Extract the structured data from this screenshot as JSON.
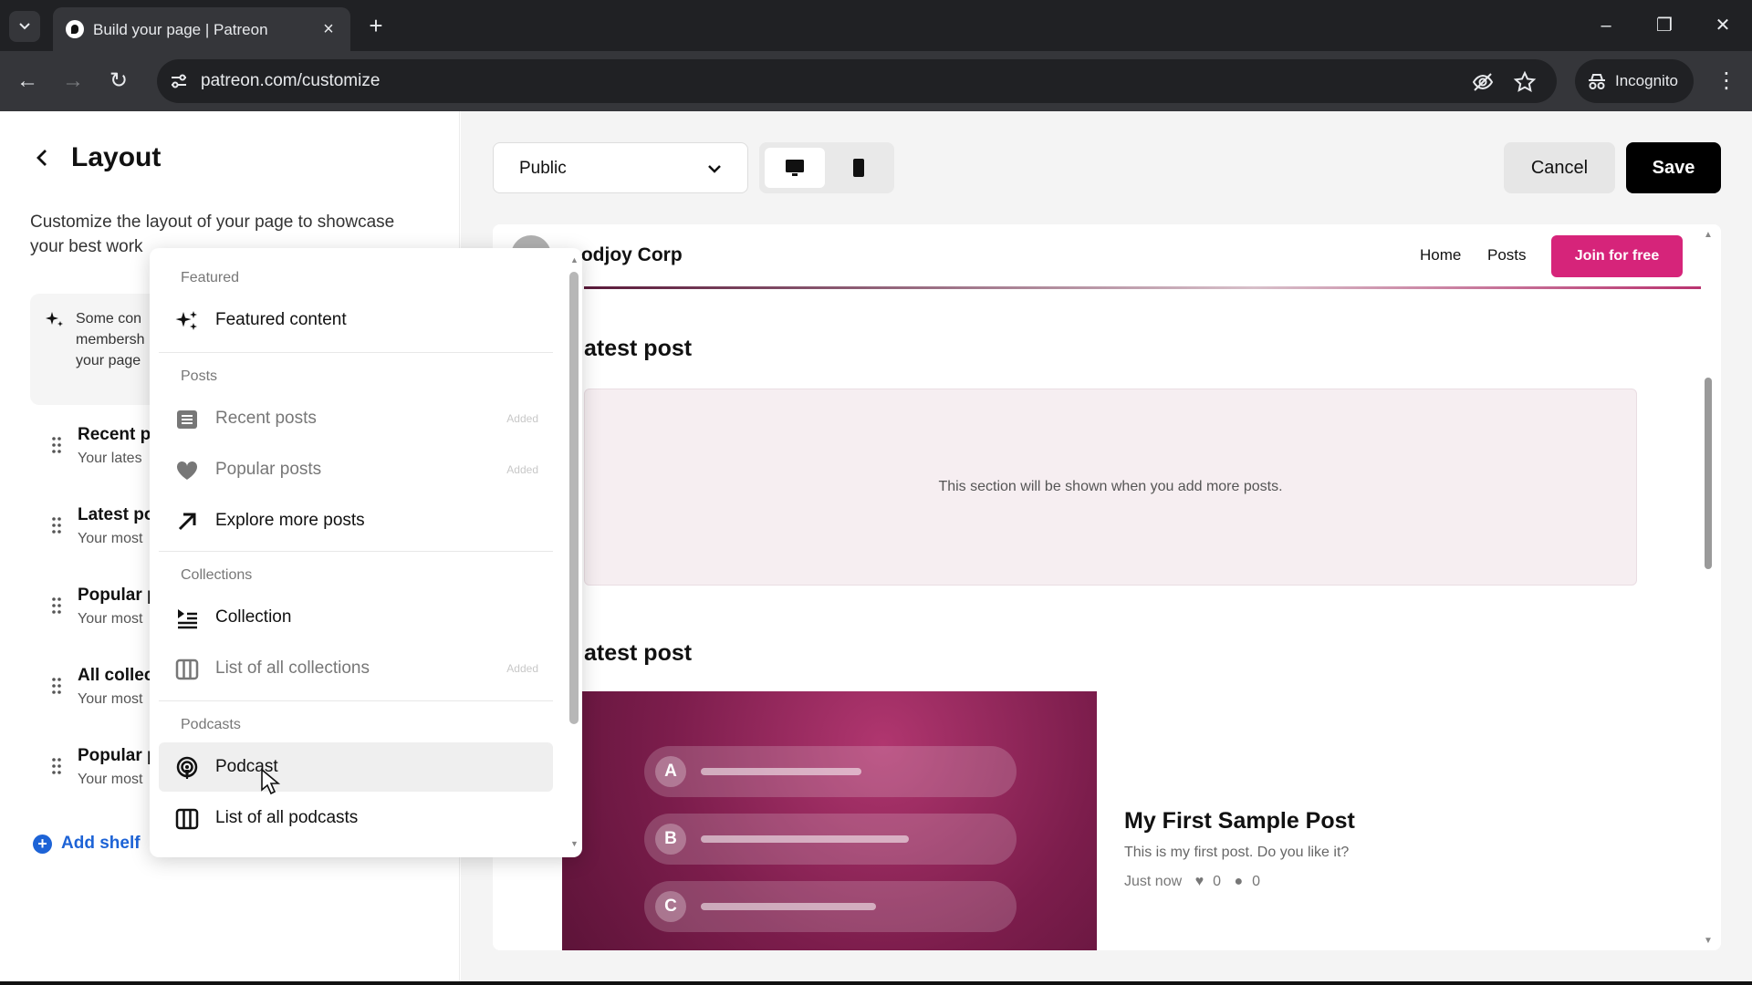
{
  "browser": {
    "tab_title": "Build your page | Patreon",
    "url": "patreon.com/customize",
    "incognito_label": "Incognito"
  },
  "left_panel": {
    "title": "Layout",
    "description": "Customize the layout of your page to showcase your best work",
    "info_lines": [
      "Some con",
      "membersh",
      "your page"
    ],
    "shelves": [
      {
        "title": "Recent p",
        "subtitle": "Your lates"
      },
      {
        "title": "Latest po",
        "subtitle": "Your most"
      },
      {
        "title": "Popular p",
        "subtitle": "Your most"
      },
      {
        "title": "All collec",
        "subtitle": "Your most"
      },
      {
        "title": "Popular p",
        "subtitle": "Your most"
      }
    ],
    "add_shelf": "Add shelf"
  },
  "menu": {
    "sections": {
      "featured": "Featured",
      "posts": "Posts",
      "collections": "Collections",
      "podcasts": "Podcasts"
    },
    "items": {
      "featured_content": {
        "label": "Featured content",
        "icon": "sparkle-icon"
      },
      "recent_posts": {
        "label": "Recent posts",
        "added": "Added",
        "icon": "list-icon"
      },
      "popular_posts": {
        "label": "Popular posts",
        "added": "Added",
        "icon": "heart-icon"
      },
      "explore_more_posts": {
        "label": "Explore more posts",
        "icon": "arrow-up-right-icon"
      },
      "collection": {
        "label": "Collection",
        "icon": "collection-icon"
      },
      "list_of_all_collections": {
        "label": "List of all collections",
        "added": "Added",
        "icon": "columns-icon"
      },
      "podcast": {
        "label": "Podcast",
        "icon": "podcast-icon"
      },
      "list_of_all_podcasts": {
        "label": "List of all podcasts",
        "icon": "columns-icon"
      }
    }
  },
  "preview_toolbar": {
    "visibility": "Public",
    "cancel": "Cancel",
    "save": "Save"
  },
  "preview": {
    "creator_name": "oodjoy Corp",
    "nav": {
      "home": "Home",
      "posts": "Posts",
      "join": "Join for free"
    },
    "section1_title": "atest post",
    "empty_text": "This section will be shown when you add more posts.",
    "section2_title": "atest post",
    "post": {
      "title": "My First Sample Post",
      "text": "This is my first post. Do you like it?",
      "time": "Just now",
      "likes": "0",
      "comments": "0"
    },
    "image_options": [
      "A",
      "B",
      "C"
    ]
  },
  "colors": {
    "join_button": "#d6247a",
    "save_button": "#000000",
    "link_blue": "#1d63d6"
  }
}
